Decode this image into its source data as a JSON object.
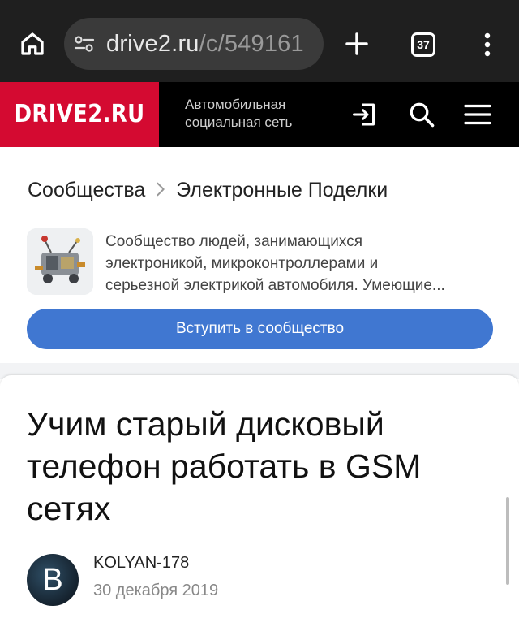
{
  "browser": {
    "url_host": "drive2.ru",
    "url_path": "/c/549161",
    "tab_count": "37"
  },
  "site": {
    "logo": "DRIVE2.RU",
    "tagline_line1": "Автомобильная",
    "tagline_line2": "социальная сеть",
    "colors": {
      "brand_red": "#d40a31",
      "header_bg": "#000000",
      "button_blue": "#4077d1"
    }
  },
  "breadcrumb": {
    "parent": "Сообщества",
    "current": "Электронные Поделки"
  },
  "community": {
    "description_lines": [
      "Сообщество людей, занимающихся",
      "электроникой, микроконтроллерами и",
      "серьезной электрикой автомобиля. Умеющие..."
    ],
    "join_label": "Вступить в сообщество"
  },
  "article": {
    "title_lines": [
      "Учим старый дисковый",
      "телефон работать в GSM",
      "сетях"
    ],
    "author": "KOLYAN-178",
    "avatar_letter": "B",
    "date": "30 декабря 2019"
  },
  "icons": {
    "home": "home-icon",
    "site_settings": "tune-icon",
    "new_tab": "plus-icon",
    "tabs": "tab-switcher-icon",
    "menu": "more-vert-icon",
    "login": "login-icon",
    "search": "search-icon",
    "hamburger": "hamburger-icon"
  }
}
